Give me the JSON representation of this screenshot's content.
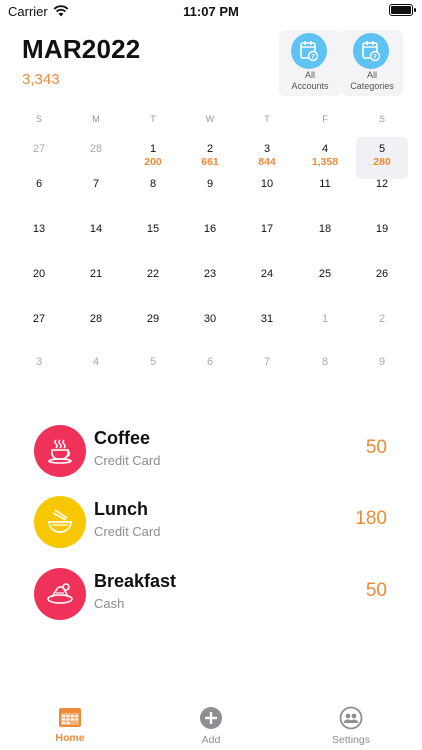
{
  "status_bar": {
    "carrier": "Carrier",
    "time": "11:07 PM"
  },
  "header": {
    "title": "MAR2022",
    "total": "3,343",
    "filters": [
      {
        "label_line1": "All",
        "label_line2": "Accounts",
        "icon": "calendar-question-icon"
      },
      {
        "label_line1": "All",
        "label_line2": "Categories",
        "icon": "calendar-question-icon"
      }
    ]
  },
  "calendar": {
    "weekdays": [
      "S",
      "M",
      "T",
      "W",
      "T",
      "F",
      "S"
    ],
    "weeks": [
      [
        {
          "day": "27",
          "muted": true
        },
        {
          "day": "28",
          "muted": true
        },
        {
          "day": "1",
          "amount": "200"
        },
        {
          "day": "2",
          "amount": "661"
        },
        {
          "day": "3",
          "amount": "844"
        },
        {
          "day": "4",
          "amount": "1,358"
        },
        {
          "day": "5",
          "amount": "280",
          "selected": true
        }
      ],
      [
        {
          "day": "6"
        },
        {
          "day": "7"
        },
        {
          "day": "8"
        },
        {
          "day": "9"
        },
        {
          "day": "10"
        },
        {
          "day": "11"
        },
        {
          "day": "12"
        }
      ],
      [
        {
          "day": "13"
        },
        {
          "day": "14"
        },
        {
          "day": "15"
        },
        {
          "day": "16"
        },
        {
          "day": "17"
        },
        {
          "day": "18"
        },
        {
          "day": "19"
        }
      ],
      [
        {
          "day": "20"
        },
        {
          "day": "21"
        },
        {
          "day": "22"
        },
        {
          "day": "23"
        },
        {
          "day": "24"
        },
        {
          "day": "25"
        },
        {
          "day": "26"
        }
      ],
      [
        {
          "day": "27"
        },
        {
          "day": "28"
        },
        {
          "day": "29"
        },
        {
          "day": "30"
        },
        {
          "day": "31"
        },
        {
          "day": "1",
          "muted": true
        },
        {
          "day": "2",
          "muted": true
        }
      ],
      [
        {
          "day": "3",
          "muted": true
        },
        {
          "day": "4",
          "muted": true
        },
        {
          "day": "5",
          "muted": true
        },
        {
          "day": "6",
          "muted": true
        },
        {
          "day": "7",
          "muted": true
        },
        {
          "day": "8",
          "muted": true
        },
        {
          "day": "9",
          "muted": true
        }
      ]
    ]
  },
  "transactions": [
    {
      "name": "Coffee",
      "account": "Credit Card",
      "amount": "50",
      "icon": "coffee-cup-icon",
      "color": "#f0325a"
    },
    {
      "name": "Lunch",
      "account": "Credit Card",
      "amount": "180",
      "icon": "noodle-bowl-icon",
      "color": "#f7c800"
    },
    {
      "name": "Breakfast",
      "account": "Cash",
      "amount": "50",
      "icon": "breakfast-plate-icon",
      "color": "#f0325a"
    }
  ],
  "tabs": [
    {
      "label": "Home",
      "icon": "calendar-home-icon",
      "active": true
    },
    {
      "label": "Add",
      "icon": "plus-circle-icon",
      "active": false
    },
    {
      "label": "Settings",
      "icon": "people-circle-icon",
      "active": false
    }
  ],
  "colors": {
    "accent": "#f08a37",
    "filter_blue": "#5ec2f2",
    "coffee_red": "#f0325a",
    "lunch_yellow": "#f7c800"
  }
}
